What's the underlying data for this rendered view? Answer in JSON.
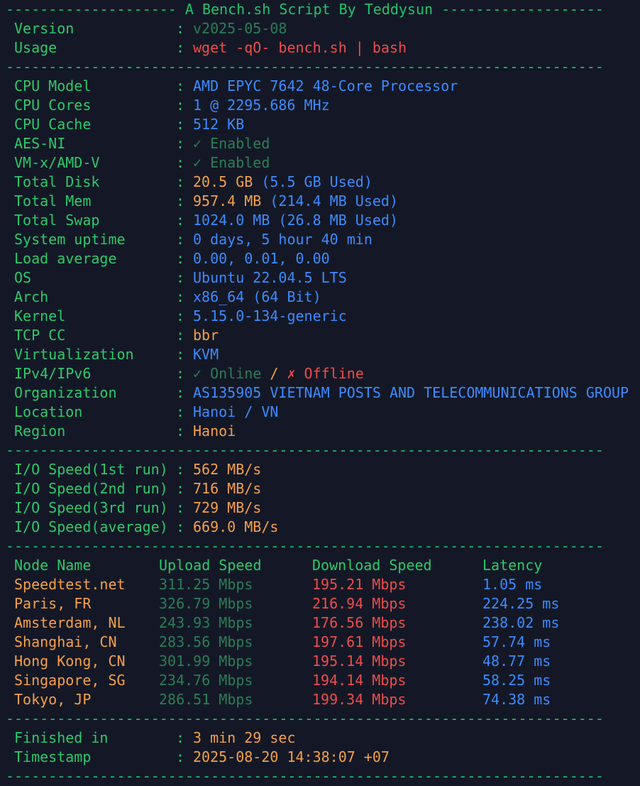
{
  "title_line": "-------------------- A Bench.sh Script By Teddysun -------------------",
  "divider": "----------------------------------------------------------------------",
  "header": {
    "version_label": "Version",
    "version_value": "v2025-05-08",
    "usage_label": "Usage",
    "usage_value": "wget -qO- bench.sh | bash"
  },
  "system": [
    {
      "label": "CPU Model",
      "value": "AMD EPYC 7642 48-Core Processor"
    },
    {
      "label": "CPU Cores",
      "value": "1 @ 2295.686 MHz"
    },
    {
      "label": "CPU Cache",
      "value": "512 KB"
    },
    {
      "label": "AES-NI",
      "value": "✓ Enabled"
    },
    {
      "label": "VM-x/AMD-V",
      "value": "✓ Enabled"
    },
    {
      "label": "Total Disk",
      "value": "20.5 GB",
      "extra": " (5.5 GB Used)"
    },
    {
      "label": "Total Mem",
      "value": "957.4 MB",
      "extra": " (214.4 MB Used)"
    },
    {
      "label": "Total Swap",
      "value": "1024.0 MB (26.8 MB Used)"
    },
    {
      "label": "System uptime",
      "value": "0 days, 5 hour 40 min"
    },
    {
      "label": "Load average",
      "value": "0.00, 0.01, 0.00"
    },
    {
      "label": "OS",
      "value": "Ubuntu 22.04.5 LTS"
    },
    {
      "label": "Arch",
      "value": "x86_64 (64 Bit)"
    },
    {
      "label": "Kernel",
      "value": "5.15.0-134-generic"
    },
    {
      "label": "TCP CC",
      "value": "bbr"
    },
    {
      "label": "Virtualization",
      "value": "KVM"
    },
    {
      "label": "IPv4/IPv6",
      "value": "✓ Online",
      "sep": " / ",
      "extra": "✗ Offline"
    },
    {
      "label": "Organization",
      "value": "AS135905 VIETNAM POSTS AND TELECOMMUNICATIONS GROUP"
    },
    {
      "label": "Location",
      "value": "Hanoi / VN"
    },
    {
      "label": "Region",
      "value": "Hanoi"
    }
  ],
  "io": [
    {
      "label": "I/O Speed(1st run)",
      "value": "562 MB/s"
    },
    {
      "label": "I/O Speed(2nd run)",
      "value": "716 MB/s"
    },
    {
      "label": "I/O Speed(3rd run)",
      "value": "729 MB/s"
    },
    {
      "label": "I/O Speed(average)",
      "value": "669.0 MB/s"
    }
  ],
  "speedtest": {
    "headers": [
      "Node Name",
      "Upload Speed",
      "Download Speed",
      "Latency"
    ],
    "rows": [
      [
        "Speedtest.net",
        "311.25 Mbps",
        "195.21 Mbps",
        "1.05 ms"
      ],
      [
        "Paris, FR",
        "326.79 Mbps",
        "216.94 Mbps",
        "224.25 ms"
      ],
      [
        "Amsterdam, NL",
        "243.93 Mbps",
        "176.56 Mbps",
        "238.02 ms"
      ],
      [
        "Shanghai, CN",
        "283.56 Mbps",
        "197.61 Mbps",
        "57.74 ms"
      ],
      [
        "Hong Kong, CN",
        "301.99 Mbps",
        "195.14 Mbps",
        "48.77 ms"
      ],
      [
        "Singapore, SG",
        "234.76 Mbps",
        "194.14 Mbps",
        "58.25 ms"
      ],
      [
        "Tokyo, JP",
        "286.51 Mbps",
        "199.34 Mbps",
        "74.38 ms"
      ]
    ]
  },
  "footer": {
    "finished_label": "Finished in",
    "finished_value": "3 min 29 sec",
    "timestamp_label": "Timestamp",
    "timestamp_value": "2025-08-20 14:38:07 +07"
  },
  "colon": ":",
  "colors": {
    "background": "#141826",
    "label": "#2dc96b",
    "value_blue": "#3d8bff",
    "value_orange": "#f5a04a",
    "value_red": "#f04c4c",
    "upload_green": "#2c7d57"
  }
}
